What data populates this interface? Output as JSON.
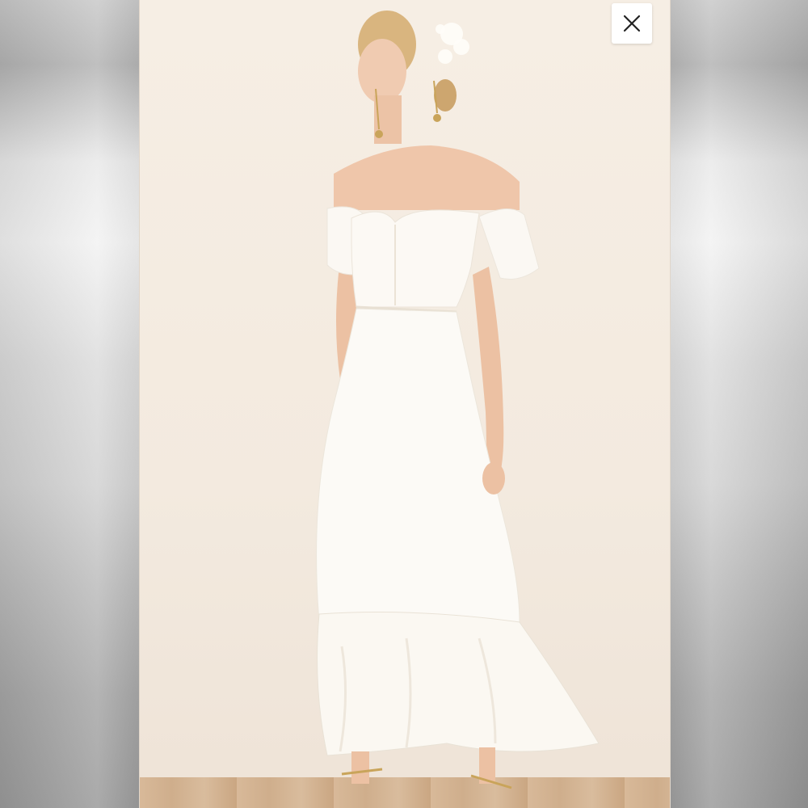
{
  "viewer": {
    "close_button": {
      "icon": "close-icon",
      "label": ""
    }
  },
  "photo": {
    "subject": "product-photo-white-dress"
  },
  "colors": {
    "backdrop": "#f4ebe1",
    "dress": "#fbf8f3",
    "close_icon": "#222222"
  }
}
